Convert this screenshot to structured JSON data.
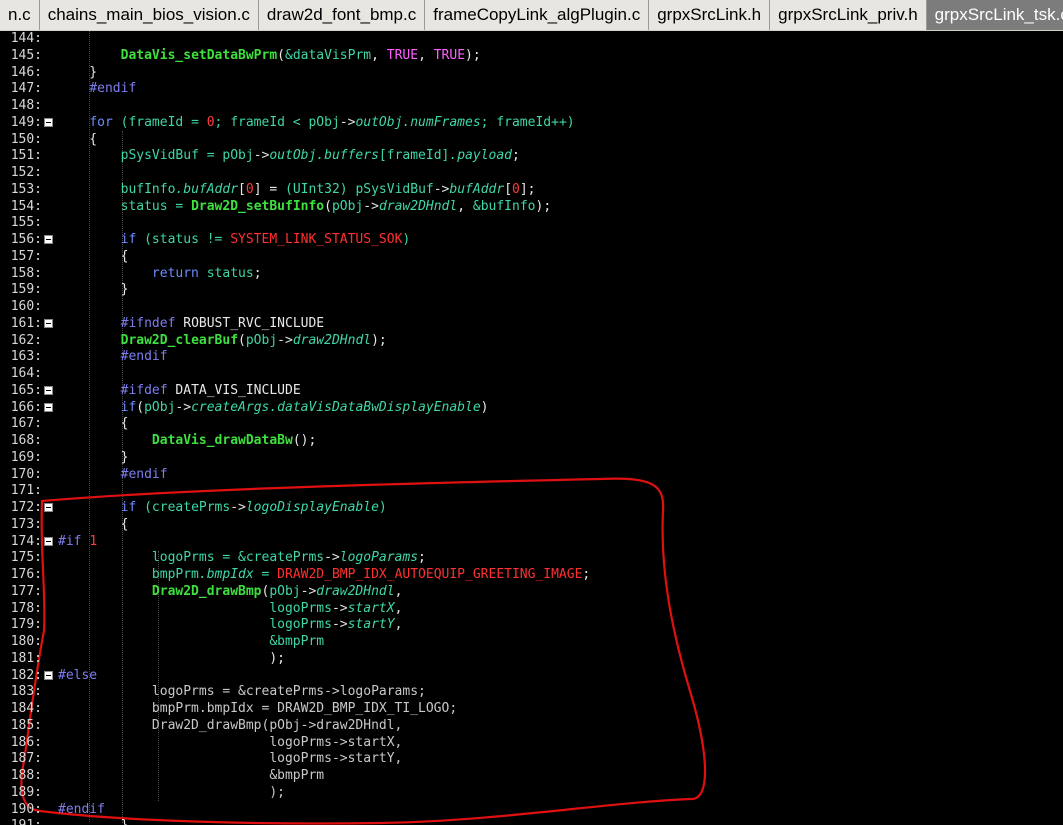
{
  "tabs": [
    {
      "label": "n.c",
      "active": false
    },
    {
      "label": "chains_main_bios_vision.c",
      "active": false
    },
    {
      "label": "draw2d_font_bmp.c",
      "active": false
    },
    {
      "label": "frameCopyLink_algPlugin.c",
      "active": false
    },
    {
      "label": "grpxSrcLink.h",
      "active": false
    },
    {
      "label": "grpxSrcLink_priv.h",
      "active": false
    },
    {
      "label": "grpxSrcLink_tsk.c",
      "active": true
    }
  ],
  "lines": [
    {
      "num": "144:",
      "fold": false,
      "html": ""
    },
    {
      "num": "145:",
      "fold": false,
      "html": "        <span class='fn'>DataVis_setDataBwPrm</span>(<span class='va'>&amp;dataVisPrm</span>, <span class='cst'>TRUE</span>, <span class='cst'>TRUE</span>);"
    },
    {
      "num": "146:",
      "fold": false,
      "html": "    }"
    },
    {
      "num": "147:",
      "fold": false,
      "html": "    <span class='pp'>#endif</span>"
    },
    {
      "num": "148:",
      "fold": false,
      "html": ""
    },
    {
      "num": "149:",
      "fold": true,
      "html": "    <span class='kw'>for</span> <span class='va'>(frameId = </span><span class='num'>0</span><span class='va'>; frameId &lt; pObj</span><span class='op'>-&gt;</span><span class='it'>outObj.numFrames</span><span class='va'>; frameId++)</span>"
    },
    {
      "num": "150:",
      "fold": false,
      "html": "    {"
    },
    {
      "num": "151:",
      "fold": false,
      "html": "        <span class='va'>pSysVidBuf = pObj</span><span class='op'>-&gt;</span><span class='it'>outObj.buffers</span><span class='va'>[frameId]</span><span class='it'>.payload</span>;"
    },
    {
      "num": "152:",
      "fold": false,
      "html": ""
    },
    {
      "num": "153:",
      "fold": false,
      "html": "        <span class='va'>bufInfo</span><span class='it'>.bufAddr</span>[<span class='num'>0</span>] = <span class='va'>(UInt32) pSysVidBuf</span><span class='op'>-&gt;</span><span class='it'>bufAddr</span>[<span class='num'>0</span>];"
    },
    {
      "num": "154:",
      "fold": false,
      "html": "        <span class='va'>status = </span><span class='fn'>Draw2D_setBufInfo</span>(<span class='va'>pObj</span><span class='op'>-&gt;</span><span class='it'>draw2DHndl</span>, <span class='va'>&amp;bufInfo</span>);"
    },
    {
      "num": "155:",
      "fold": false,
      "html": ""
    },
    {
      "num": "156:",
      "fold": true,
      "html": "        <span class='kw'>if</span> <span class='va'>(status != </span><span class='mac'>SYSTEM_LINK_STATUS_SOK</span><span class='va'>)</span>"
    },
    {
      "num": "157:",
      "fold": false,
      "html": "        {"
    },
    {
      "num": "158:",
      "fold": false,
      "html": "            <span class='kw'>return</span> <span class='va'>status</span>;"
    },
    {
      "num": "159:",
      "fold": false,
      "html": "        }"
    },
    {
      "num": "160:",
      "fold": false,
      "html": ""
    },
    {
      "num": "161:",
      "fold": true,
      "html": "        <span class='pp'>#ifndef</span> ROBUST_RVC_INCLUDE"
    },
    {
      "num": "162:",
      "fold": false,
      "html": "        <span class='fn'>Draw2D_clearBuf</span>(<span class='va'>pObj</span><span class='op'>-&gt;</span><span class='it'>draw2DHndl</span>);"
    },
    {
      "num": "163:",
      "fold": false,
      "html": "        <span class='pp'>#endif</span>"
    },
    {
      "num": "164:",
      "fold": false,
      "html": ""
    },
    {
      "num": "165:",
      "fold": true,
      "html": "        <span class='pp'>#ifdef</span> DATA_VIS_INCLUDE"
    },
    {
      "num": "166:",
      "fold": true,
      "html": "        <span class='kw'>if</span>(<span class='va'>pObj</span><span class='op'>-&gt;</span><span class='it'>createArgs.dataVisDataBwDisplayEnable</span>)"
    },
    {
      "num": "167:",
      "fold": false,
      "html": "        {"
    },
    {
      "num": "168:",
      "fold": false,
      "html": "            <span class='fn'>DataVis_drawDataBw</span>();"
    },
    {
      "num": "169:",
      "fold": false,
      "html": "        }"
    },
    {
      "num": "170:",
      "fold": false,
      "html": "        <span class='pp'>#endif</span>"
    },
    {
      "num": "171:",
      "fold": false,
      "html": ""
    },
    {
      "num": "172:",
      "fold": true,
      "html": "        <span class='kw'>if</span> <span class='va'>(createPrms</span><span class='op'>-&gt;</span><span class='it'>logoDisplayEnable</span><span class='va'>)</span>"
    },
    {
      "num": "173:",
      "fold": false,
      "html": "        {"
    },
    {
      "num": "174:",
      "fold": true,
      "html": "<span class='pp'>#if</span> <span class='num'>1</span>"
    },
    {
      "num": "175:",
      "fold": false,
      "html": "            <span class='va'>logoPrms = &amp;createPrms</span><span class='op'>-&gt;</span><span class='it'>logoParams</span>;"
    },
    {
      "num": "176:",
      "fold": false,
      "html": "            <span class='va'>bmpPrm</span><span class='it'>.bmpIdx</span><span class='va'> = </span><span class='mac'>DRAW2D_BMP_IDX_AUTOEQUIP_GREETING_IMAGE</span>;"
    },
    {
      "num": "177:",
      "fold": false,
      "html": "            <span class='fn'>Draw2D_drawBmp</span>(<span class='va'>pObj</span><span class='op'>-&gt;</span><span class='it'>draw2DHndl</span>,"
    },
    {
      "num": "178:",
      "fold": false,
      "html": "                           <span class='va'>logoPrms</span><span class='op'>-&gt;</span><span class='it'>startX</span>,"
    },
    {
      "num": "179:",
      "fold": false,
      "html": "                           <span class='va'>logoPrms</span><span class='op'>-&gt;</span><span class='it'>startY</span>,"
    },
    {
      "num": "180:",
      "fold": false,
      "html": "                           <span class='va'>&amp;bmpPrm</span>"
    },
    {
      "num": "181:",
      "fold": false,
      "html": "                           );"
    },
    {
      "num": "182:",
      "fold": true,
      "html": "<span class='pp'>#else</span>"
    },
    {
      "num": "183:",
      "fold": false,
      "html": "            <span class='dim'>logoPrms = &amp;createPrms-&gt;logoParams;</span>"
    },
    {
      "num": "184:",
      "fold": false,
      "html": "            <span class='dim'>bmpPrm.bmpIdx = DRAW2D_BMP_IDX_TI_LOGO;</span>"
    },
    {
      "num": "185:",
      "fold": false,
      "html": "            <span class='dim'>Draw2D_drawBmp(pObj-&gt;draw2DHndl,</span>"
    },
    {
      "num": "186:",
      "fold": false,
      "html": "                           <span class='dim'>logoPrms-&gt;startX,</span>"
    },
    {
      "num": "187:",
      "fold": false,
      "html": "                           <span class='dim'>logoPrms-&gt;startY,</span>"
    },
    {
      "num": "188:",
      "fold": false,
      "html": "                           <span class='dim'>&amp;bmpPrm</span>"
    },
    {
      "num": "189:",
      "fold": false,
      "html": "                           <span class='dim'>);</span>"
    },
    {
      "num": "190:",
      "fold": false,
      "html": "<span class='pp'>#endif</span>"
    },
    {
      "num": "191:",
      "fold": false,
      "html": "        }"
    }
  ],
  "colors": {
    "background": "#000000",
    "annotation": "#e01010",
    "active_tab": "#7c7c7c"
  }
}
